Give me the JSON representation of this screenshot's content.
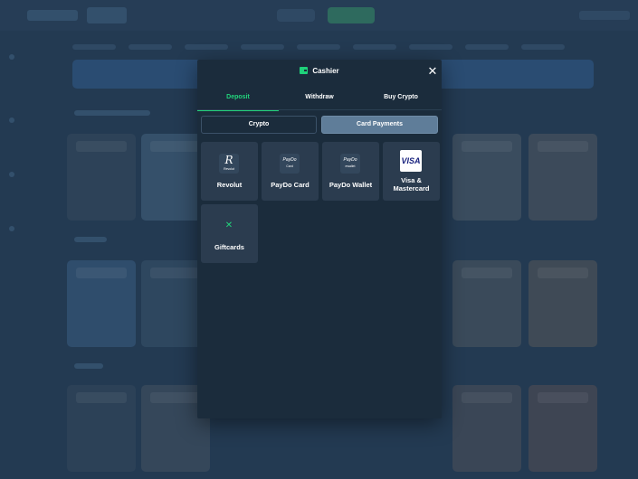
{
  "modal": {
    "title": "Cashier",
    "title_icon": "wallet-icon",
    "close_glyph": "✕",
    "tabs": [
      {
        "label": "Deposit",
        "active": true
      },
      {
        "label": "Withdraw",
        "active": false
      },
      {
        "label": "Buy Crypto",
        "active": false
      }
    ],
    "payment_types": [
      {
        "label": "Crypto",
        "active": false
      },
      {
        "label": "Card Payments",
        "active": true
      }
    ],
    "methods": [
      {
        "label": "Revolut",
        "icon": "revolut-icon",
        "icon_text": "R",
        "icon_subtext": "Revolut"
      },
      {
        "label": "PayDo Card",
        "icon": "paydo-card-icon",
        "icon_text": "PayDo",
        "icon_subtext": "Card"
      },
      {
        "label": "PayDo Wallet",
        "icon": "paydo-wallet-icon",
        "icon_text": "PayDo",
        "icon_subtext": "ewallet"
      },
      {
        "label": "Visa & Mastercard",
        "icon": "visa-icon",
        "icon_text": "VISA"
      },
      {
        "label": "Giftcards",
        "icon": "giftcard-icon",
        "icon_text": "✕"
      }
    ]
  },
  "colors": {
    "accent": "#22d47c",
    "modal_bg": "#1b2c3c",
    "tile_bg": "#2b3c4f",
    "segment_active": "#5f7d99",
    "backdrop": "#233a52"
  }
}
